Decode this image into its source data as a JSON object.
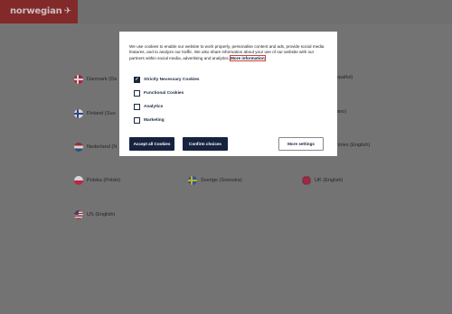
{
  "brand": {
    "logo_text": "norwegian",
    "logo_icon": "plane-icon"
  },
  "countries": [
    {
      "label": "Danmark (Da",
      "flag": "denmark"
    },
    {
      "label": "Finland (Suo",
      "flag": "finland"
    },
    {
      "label": "Nederland (N",
      "flag": "netherlands"
    },
    {
      "label": "Polska (Polski)",
      "flag": "poland"
    },
    {
      "label": "Sverige (Svenska)",
      "flag": "sweden"
    },
    {
      "label": "UK (English)",
      "flag": "uk"
    },
    {
      "label": "US (English)",
      "flag": "us"
    },
    {
      "label": "spañol)",
      "flag": ""
    },
    {
      "label": "ano)",
      "flag": ""
    },
    {
      "label": "ntries (English)",
      "flag": ""
    }
  ],
  "cookie": {
    "text": "We use cookies to enable our website to work properly, personalise content and ads, provide social media features, and to analyze our traffic. We also share information about your use of our website with our partners within social media, advertising and analytics.",
    "more_link": "More information",
    "options": [
      {
        "label": "Strictly Necessary Cookies",
        "checked": true
      },
      {
        "label": "Functional Cookies",
        "checked": false
      },
      {
        "label": "Analytics",
        "checked": false
      },
      {
        "label": "Marketing",
        "checked": false
      }
    ],
    "accept_all": "Accept all Cookies",
    "confirm": "Confirm choices",
    "more_settings": "More settings"
  }
}
